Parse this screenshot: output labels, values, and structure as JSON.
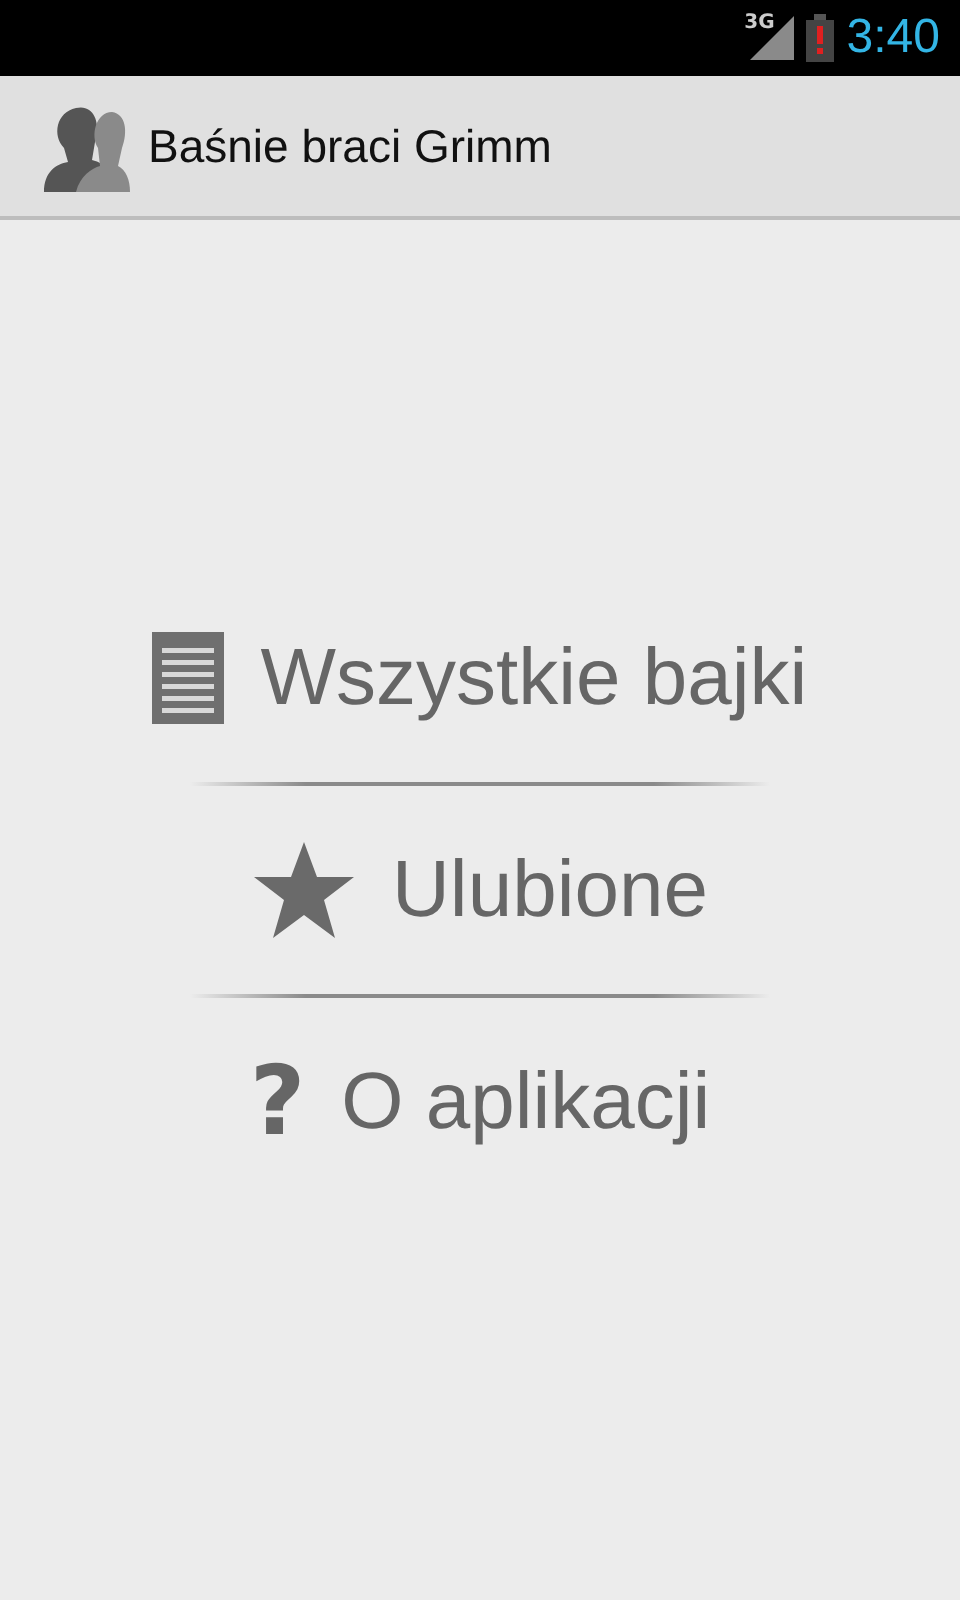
{
  "status_bar": {
    "network": "3G",
    "time": "3:40"
  },
  "action_bar": {
    "title": "Baśnie braci Grimm"
  },
  "menu": [
    {
      "kind": "list",
      "label": "Wszystkie bajki"
    },
    {
      "kind": "star",
      "label": "Ulubione"
    },
    {
      "kind": "glyph",
      "glyph": "?",
      "label": "O aplikacji"
    }
  ]
}
